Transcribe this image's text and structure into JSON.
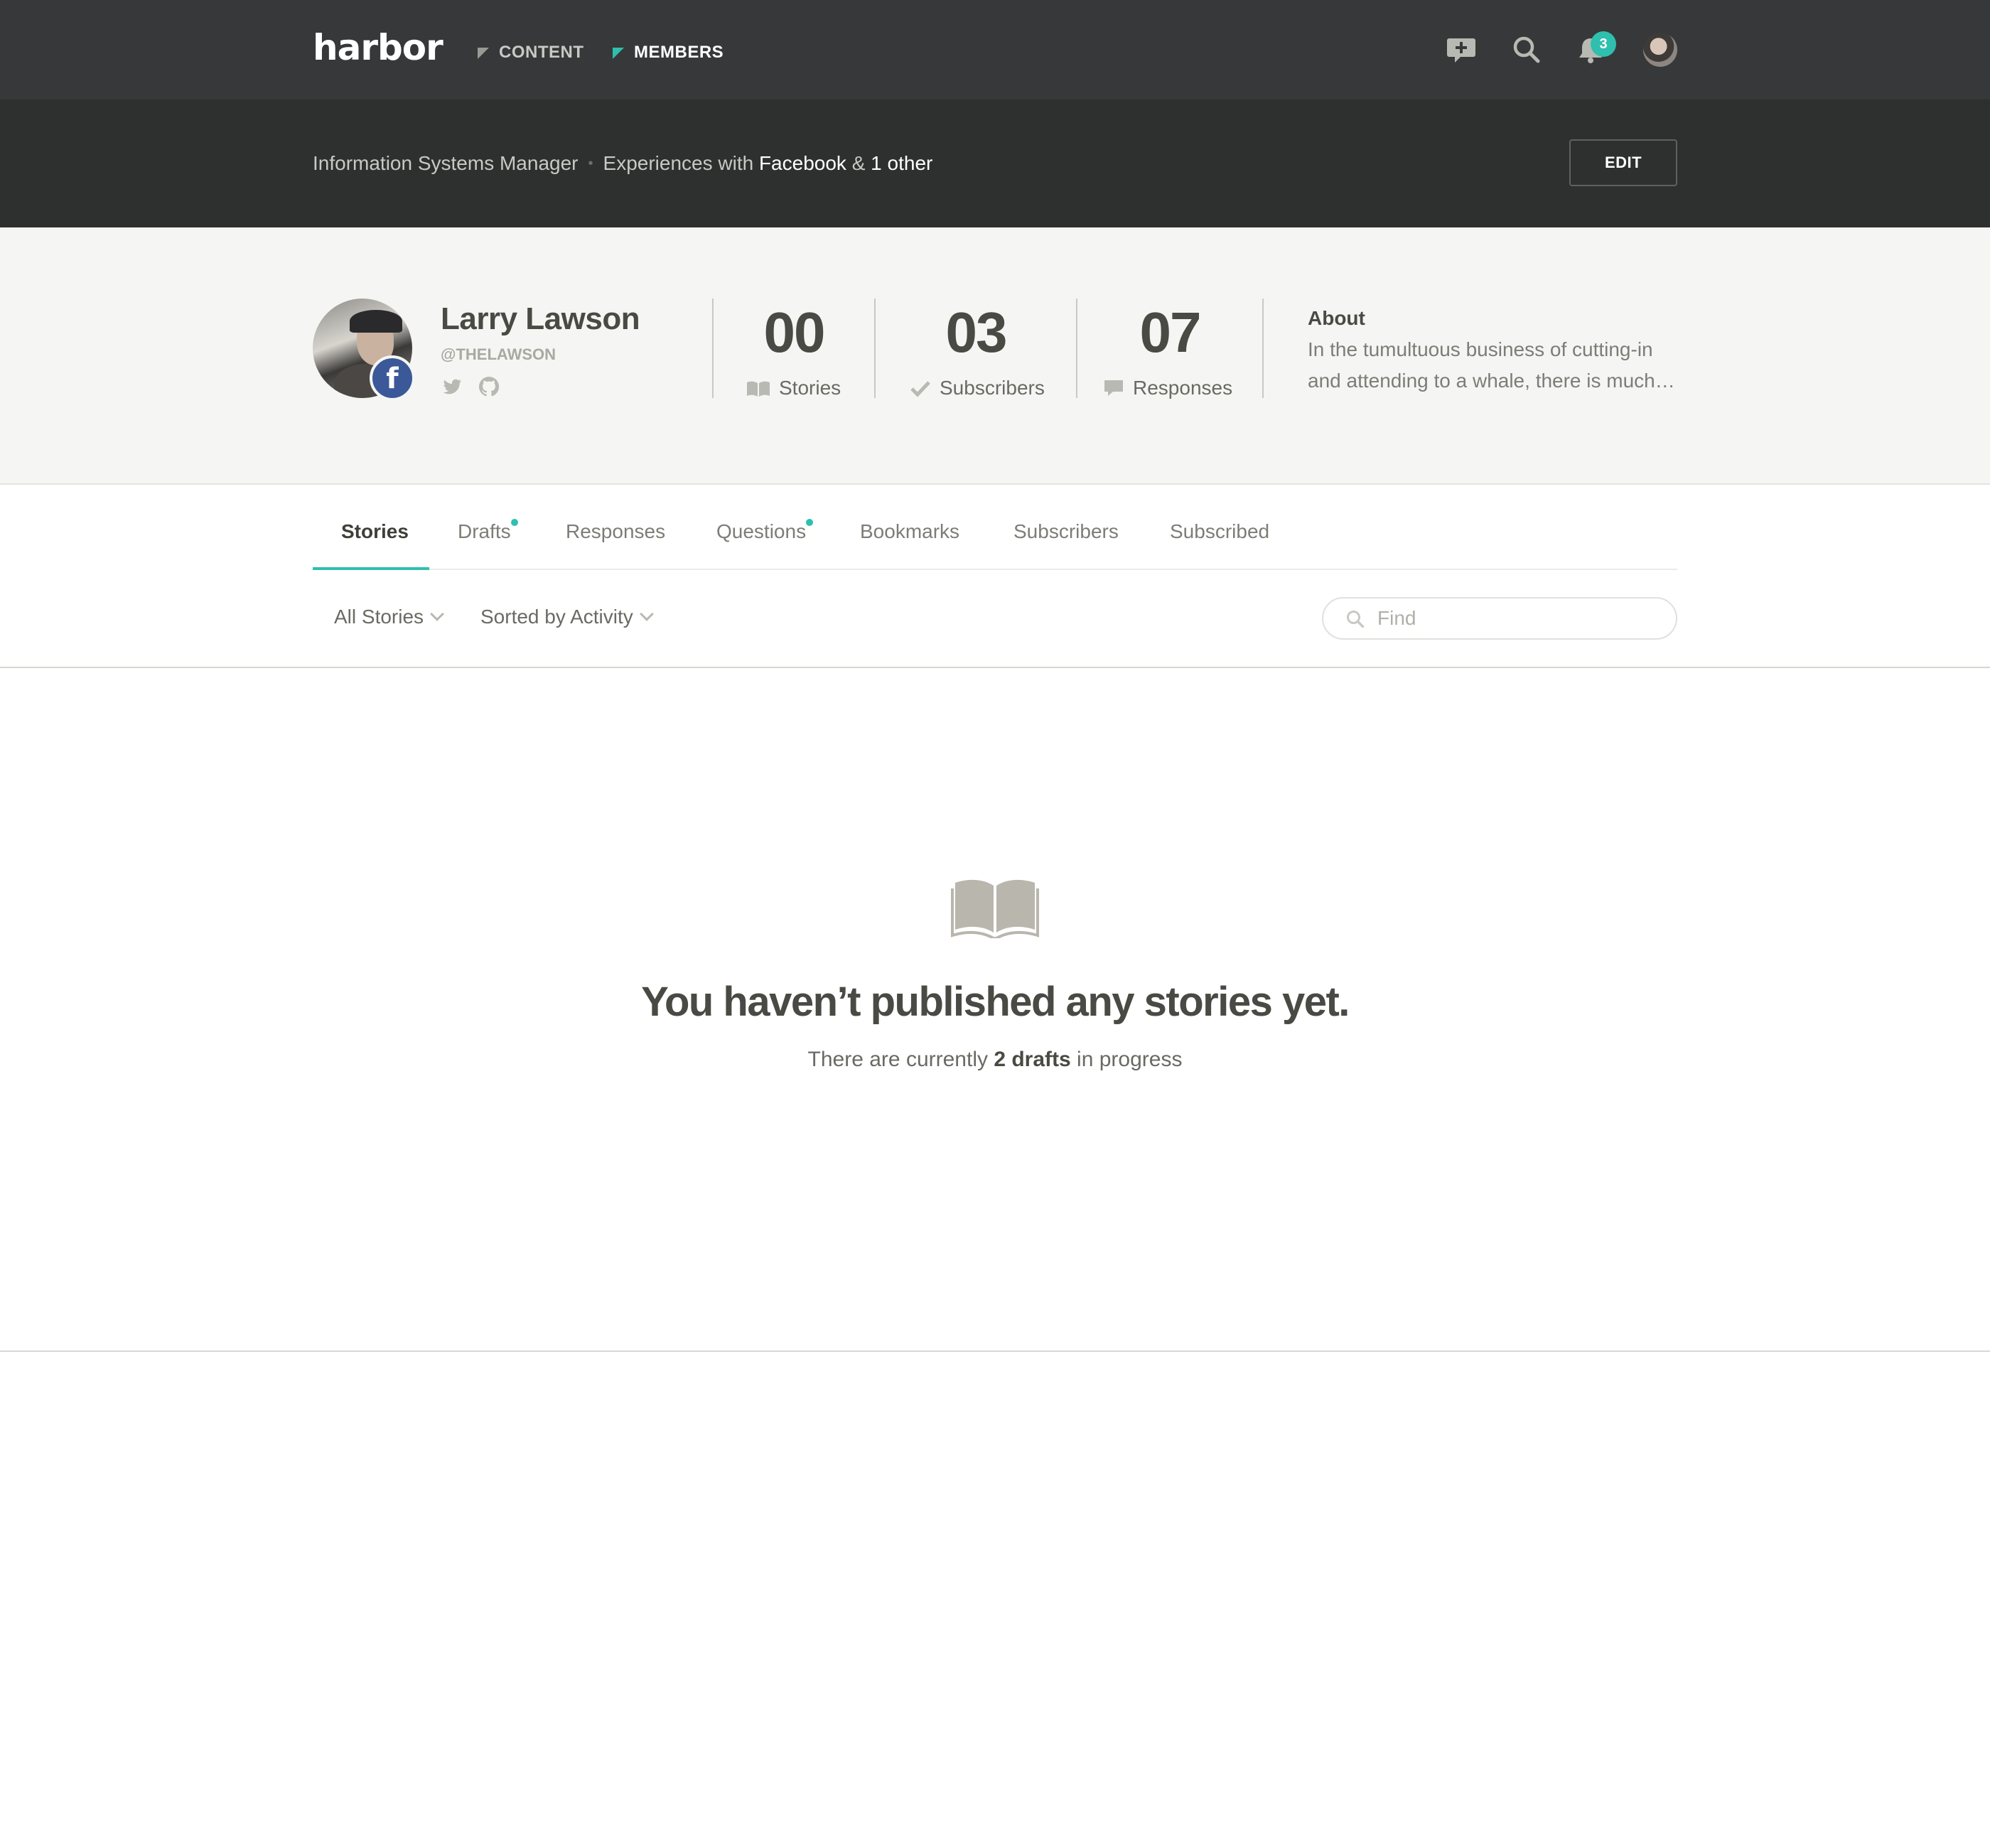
{
  "app": {
    "logo": "harbor"
  },
  "nav": {
    "items": [
      {
        "label": "CONTENT",
        "active": false
      },
      {
        "label": "MEMBERS",
        "active": true
      }
    ],
    "notifications_count": "3"
  },
  "subheader": {
    "role": "Information Systems Manager",
    "experience_prefix": "Experiences with",
    "experience_primary": "Facebook",
    "experience_join": "&",
    "experience_other": "1 other",
    "edit_label": "EDIT"
  },
  "profile": {
    "name": "Larry Lawson",
    "handle": "@THELAWSON",
    "social_icons": [
      "twitter-icon",
      "github-icon"
    ],
    "stats": [
      {
        "value": "00",
        "label": "Stories",
        "icon": "book-icon"
      },
      {
        "value": "03",
        "label": "Subscribers",
        "icon": "check-icon"
      },
      {
        "value": "07",
        "label": "Responses",
        "icon": "speech-bubble-icon"
      }
    ],
    "about_title": "About",
    "about_text": "In the tumultuous business of cutting-in and attending to a whale, there is much…"
  },
  "tabs": [
    {
      "label": "Stories",
      "active": true,
      "dot": false
    },
    {
      "label": "Drafts",
      "active": false,
      "dot": true
    },
    {
      "label": "Responses",
      "active": false,
      "dot": false
    },
    {
      "label": "Questions",
      "active": false,
      "dot": true
    },
    {
      "label": "Bookmarks",
      "active": false,
      "dot": false
    },
    {
      "label": "Subscribers",
      "active": false,
      "dot": false
    },
    {
      "label": "Subscribed",
      "active": false,
      "dot": false
    }
  ],
  "filters": {
    "scope": "All Stories",
    "sort": "Sorted by Activity",
    "search_placeholder": "Find"
  },
  "empty_state": {
    "icon": "open-book-icon",
    "title": "You haven’t published any stories yet.",
    "sub_prefix": "There are currently",
    "sub_count": "2 drafts",
    "sub_suffix": "in progress"
  },
  "colors": {
    "accent": "#2fbfae",
    "nav_bg": "#363839",
    "subheader_bg": "#2e302f",
    "profile_bg": "#f5f5f3",
    "facebook": "#3b5998"
  }
}
